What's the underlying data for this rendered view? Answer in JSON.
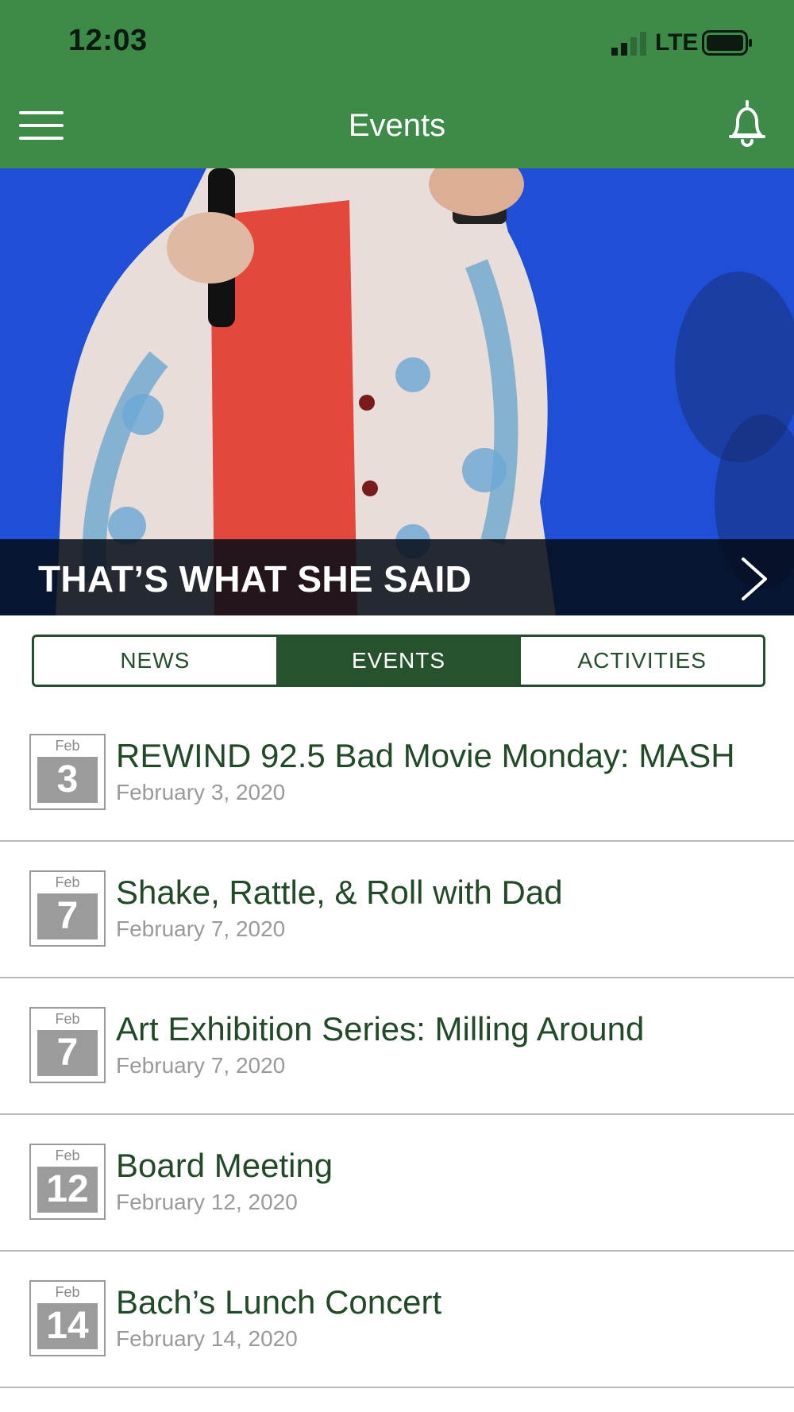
{
  "status_bar": {
    "time": "12:03",
    "network": "LTE"
  },
  "nav": {
    "title": "Events",
    "menu_icon": "hamburger-menu-icon",
    "notify_icon": "bell-icon"
  },
  "hero": {
    "title": "THAT’S WHAT SHE SAID",
    "arrow_icon": "chevron-right-icon"
  },
  "tabs": [
    {
      "label": "NEWS",
      "active": false
    },
    {
      "label": "EVENTS",
      "active": true
    },
    {
      "label": "ACTIVITIES",
      "active": false
    }
  ],
  "events": [
    {
      "month": "Feb",
      "day": "3",
      "title": "REWIND 92.5 Bad Movie Monday: MASH",
      "date": "February 3, 2020"
    },
    {
      "month": "Feb",
      "day": "7",
      "title": "Shake, Rattle, & Roll with Dad",
      "date": "February 7, 2020"
    },
    {
      "month": "Feb",
      "day": "7",
      "title": "Art Exhibition Series: Milling Around",
      "date": "February 7, 2020"
    },
    {
      "month": "Feb",
      "day": "12",
      "title": "Board Meeting",
      "date": "February 12, 2020"
    },
    {
      "month": "Feb",
      "day": "14",
      "title": "Bach’s Lunch Concert",
      "date": "February 14, 2020"
    }
  ],
  "colors": {
    "header_green": "#3d8a49",
    "dark_green": "#26522d",
    "text_green": "#214a27",
    "hero_blue": "#1f4fd6"
  }
}
